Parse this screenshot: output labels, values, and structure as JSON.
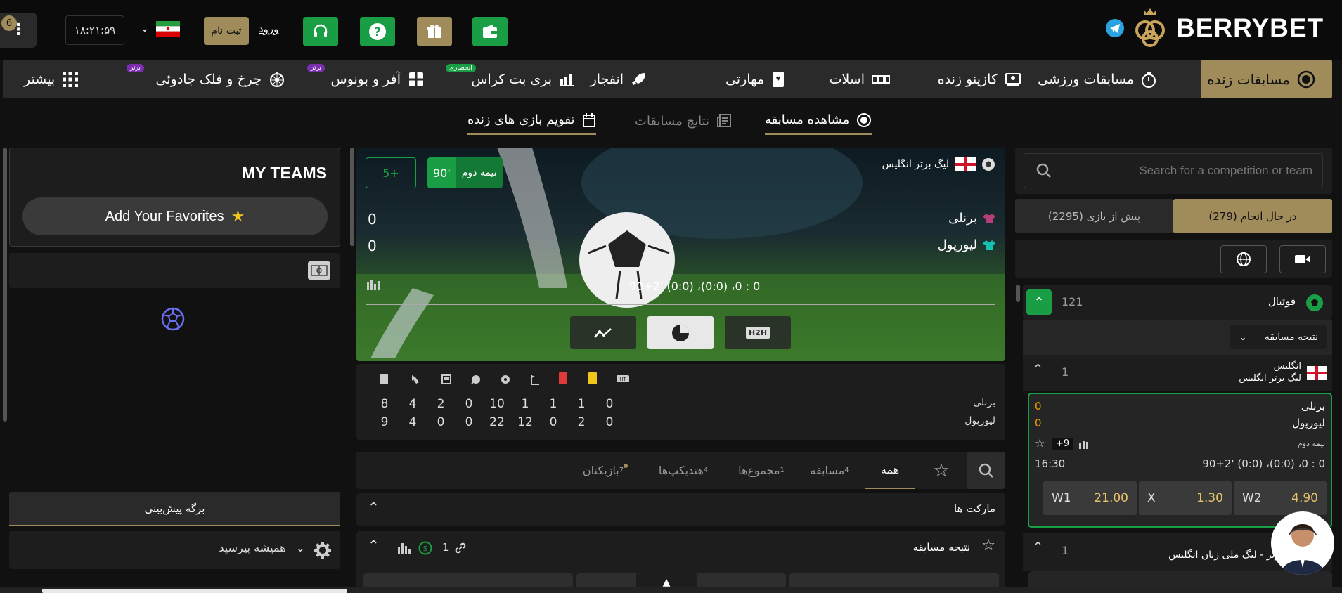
{
  "header": {
    "brand": "BERRYBET",
    "menu_count": "6",
    "clock": "۱۸:۲۱:۵۹",
    "register": "ثبت نام",
    "login": "ورود"
  },
  "nav": {
    "items": [
      {
        "label": "مسابقات زنده",
        "icon": "live-dot-icon"
      },
      {
        "label": "مسابقات ورزشی",
        "icon": "stopwatch-icon"
      },
      {
        "label": "کازینو زنده",
        "icon": "casino-icon"
      },
      {
        "label": "اسلات",
        "icon": "slot-icon"
      },
      {
        "label": "مهارتی",
        "icon": "cards-icon"
      },
      {
        "label": "انفجار",
        "icon": "rocket-icon"
      },
      {
        "label": "بری بت کراس",
        "icon": "bars-icon",
        "badge": "انحصاری"
      },
      {
        "label": "آفر و بونوس",
        "icon": "gift-box-icon",
        "badge": "برتر"
      },
      {
        "label": "چرخ و فلک جادوئی",
        "icon": "wheel-icon",
        "badge": "برتر"
      },
      {
        "label": "بیشتر",
        "icon": "grid-icon"
      }
    ]
  },
  "subnav": {
    "view_match": "مشاهده مسابقه",
    "results": "نتایج مسابقات",
    "calendar": "تقویم بازی های زنده"
  },
  "left": {
    "search_placeholder": "Search for a competition or team",
    "tab_live": "در حال انجام (279)",
    "tab_pre": "پیش از بازی (2295)",
    "sport": "فوتبال",
    "sport_count": "121",
    "market_select": "نتیجه مسابقه",
    "league1_country": "انگلیس",
    "league1_name": "لیگ برتر انگلیس",
    "league1_count": "1",
    "team1": "برنلی",
    "team2": "لیورپول",
    "score1": "0",
    "score2": "0",
    "half": "نیمه دوم",
    "more_markets": "+9",
    "time": "16:30",
    "detail": "0 : 0، (0:0)، (0:0) '90+2",
    "odds": [
      {
        "label": "W1",
        "value": "21.00"
      },
      {
        "label": "X",
        "value": "1.30"
      },
      {
        "label": "W2",
        "value": "4.90"
      }
    ],
    "league2_name": "برتر - لیگ ملی زنان انگلیس",
    "league2_count": "1"
  },
  "center": {
    "league": "لیگ برتر انگلیس",
    "team1": "برنلی",
    "team2": "لیورپول",
    "score1": "0",
    "score2": "0",
    "half": "نیمه دوم",
    "minute": "90'",
    "extra": "5+",
    "detail": "0 : 0، (0:0)، (0:0) '90+2",
    "h2h": "H2H",
    "stats_team1": "برنلی",
    "stats_team2": "لیورپول",
    "stats1": [
      "0",
      "1",
      "1",
      "1",
      "10",
      "0",
      "2",
      "4",
      "8"
    ],
    "stats2": [
      "0",
      "2",
      "0",
      "12",
      "22",
      "0",
      "0",
      "4",
      "9"
    ],
    "market_tabs": [
      {
        "label": "همه",
        "sup": ""
      },
      {
        "label": "مسابقه",
        "sup": "4"
      },
      {
        "label": "مجموع‌ها",
        "sup": "1"
      },
      {
        "label": "هندیکپ‌ها",
        "sup": "4"
      },
      {
        "label": "بازیکنان",
        "sup": "7"
      }
    ],
    "markets_header": "مارکت ها",
    "market1": "نتیجه مسابقه",
    "market1_count": "1"
  },
  "right": {
    "my_teams": "MY TEAMS",
    "add_fav": "Add Your Favorites",
    "betslip": "برگه پیش‌بینی",
    "always_ask": "همیشه بپرسید"
  },
  "colors": {
    "green": "#1a9e45",
    "gold": "#a08b5a",
    "odd": "#e6c36a"
  }
}
